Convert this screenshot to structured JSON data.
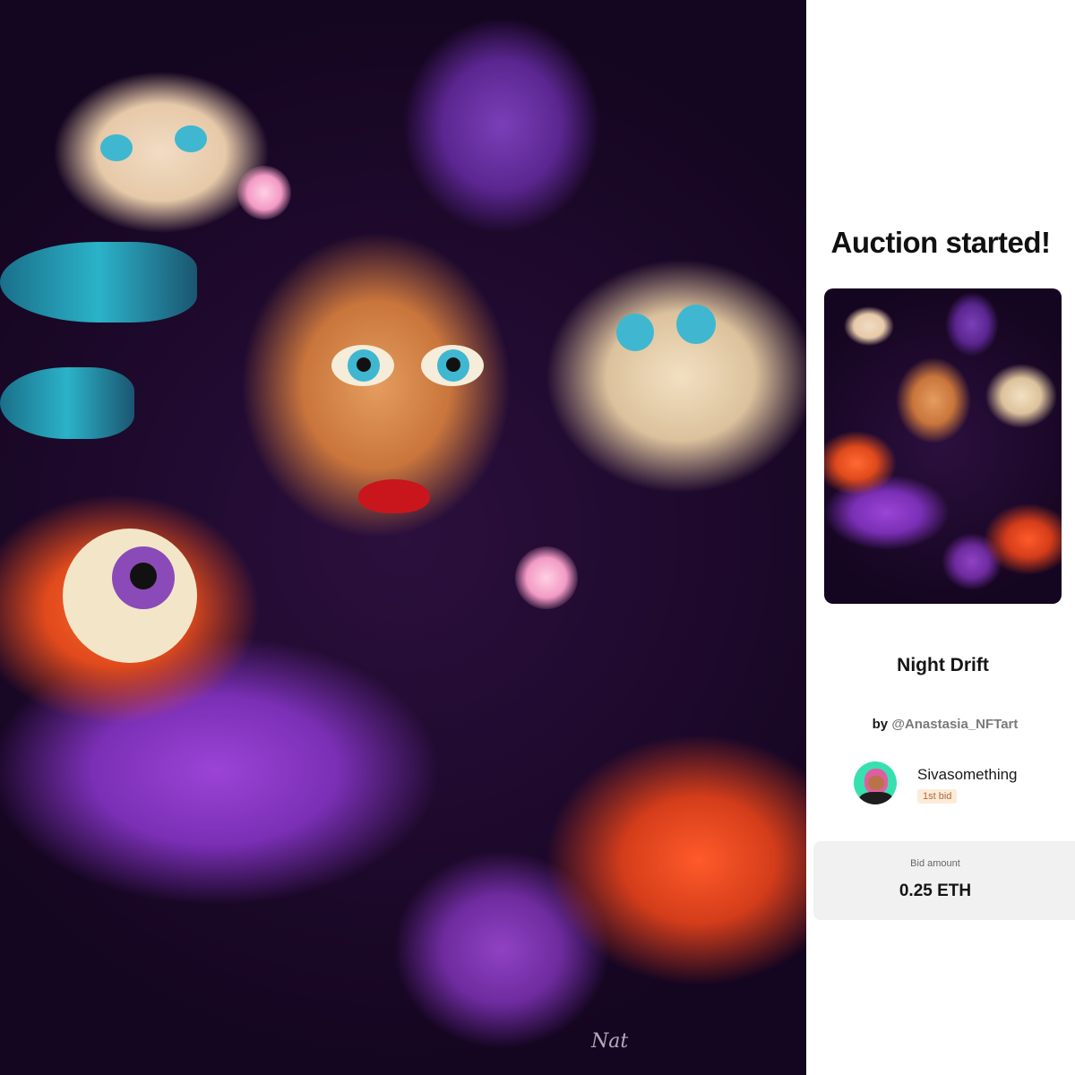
{
  "panel": {
    "title": "Auction started!"
  },
  "artwork": {
    "name": "Night Drift",
    "by_prefix": "by",
    "artist_handle": "@Anastasia_NFTart"
  },
  "bidder": {
    "name": "Sivasomething",
    "badge": "1st bid"
  },
  "bid": {
    "label": "Bid amount",
    "value": "0.25 ETH"
  }
}
